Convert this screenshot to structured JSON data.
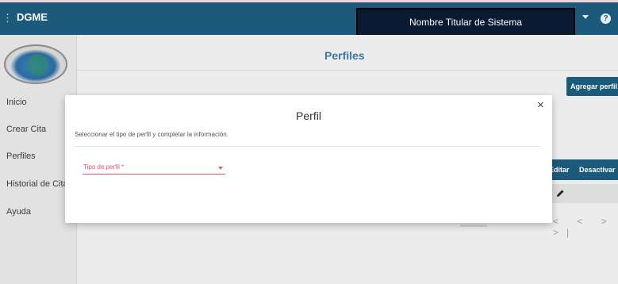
{
  "header": {
    "brand": "DGME",
    "titular": "Nombre Titular de Sistema"
  },
  "sidebar": {
    "items": [
      {
        "label": "Inicio"
      },
      {
        "label": "Crear Cita"
      },
      {
        "label": "Perfiles"
      },
      {
        "label": "Historial de Citas"
      },
      {
        "label": "Ayuda"
      }
    ]
  },
  "main": {
    "title": "Perfiles",
    "add_button": "Agregar perfil",
    "table": {
      "columns": [
        "Editar",
        "Desactivar"
      ]
    },
    "pager": "< < > >|"
  },
  "modal": {
    "title": "Perfil",
    "close": "×",
    "instructions": "Seleccionar el tipo de perfil y completar la información.",
    "select_label": "Tipo de perfil *"
  },
  "colors": {
    "primary": "#1b5a7a",
    "required": "#e25668",
    "titular_box": "#0b1a33"
  }
}
